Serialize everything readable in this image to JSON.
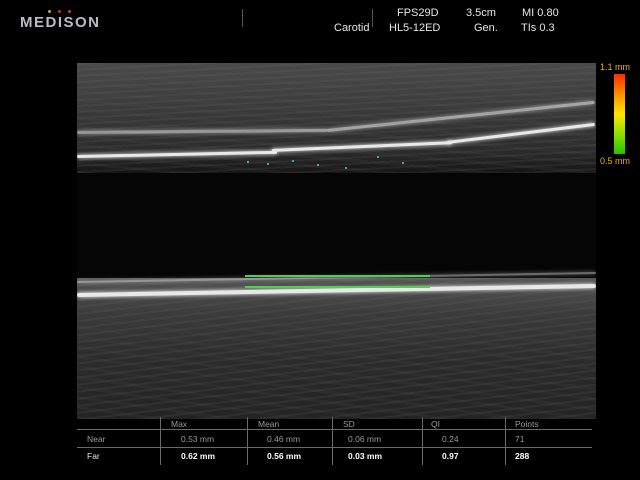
{
  "header": {
    "brand": "MEDISON",
    "brand_dot_colors": [
      "#d0a030",
      "#c03030",
      "#d04020"
    ],
    "application": "Carotid",
    "preset": "FPS29D",
    "probe": "HL5-12ED",
    "depth": "3.5cm",
    "mode": "Gen.",
    "mi": "MI 0.80",
    "tis": "TIs 0.3"
  },
  "color_scale": {
    "max_label": "1.1 mm",
    "min_label": "0.5 mm",
    "colors": [
      "#ff2a00",
      "#ff8c00",
      "#ffe600",
      "#8fe000",
      "#22c400"
    ]
  },
  "overlays": {
    "imt_trace_color": "#4fd04a",
    "near_wall_marker_color": "#3fa7a7"
  },
  "stats": {
    "columns": [
      "",
      "Max",
      "Mean",
      "SD",
      "QI",
      "Points"
    ],
    "rows": [
      {
        "label": "Near",
        "max": "0.53 mm",
        "mean": "0.46 mm",
        "sd": "0.06 mm",
        "qi": "0.24",
        "points": "71"
      },
      {
        "label": "Far",
        "max": "0.62 mm",
        "mean": "0.56 mm",
        "sd": "0.03 mm",
        "qi": "0.97",
        "points": "288"
      }
    ]
  }
}
